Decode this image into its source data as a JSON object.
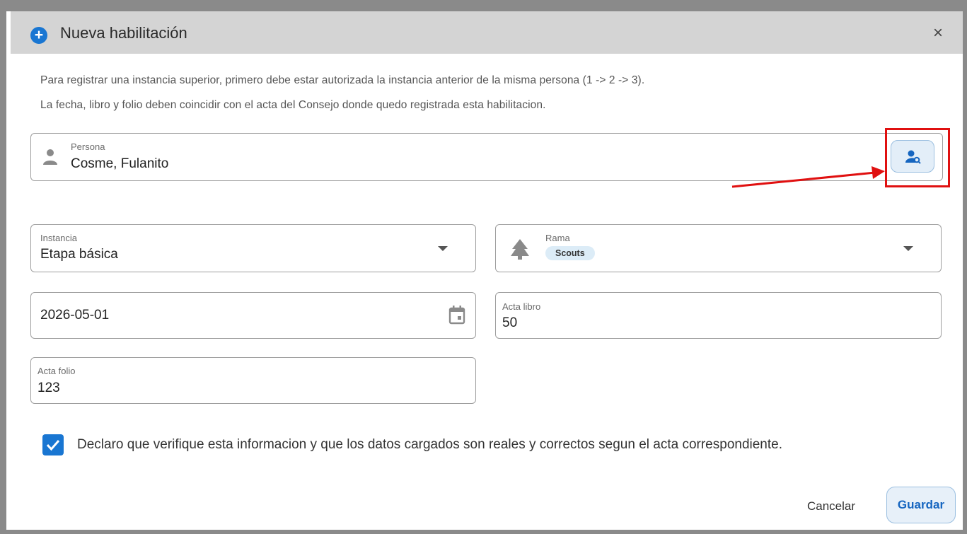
{
  "dialog": {
    "title": "Nueva habilitación",
    "close_label": "×"
  },
  "info": {
    "line1": "Para registrar una instancia superior, primero debe estar autorizada la instancia anterior de la misma persona (1 -> 2 -> 3).",
    "line2": "La fecha, libro y folio deben coincidir con el acta del Consejo donde quedo registrada esta habilitacion."
  },
  "persona": {
    "label": "Persona",
    "value": "Cosme, Fulanito"
  },
  "instancia": {
    "label": "Instancia",
    "value": "Etapa básica"
  },
  "rama": {
    "label": "Rama",
    "chip": "Scouts"
  },
  "fecha": {
    "value": "2026-05-01"
  },
  "acta_libro": {
    "label": "Acta libro",
    "value": "50"
  },
  "acta_folio": {
    "label": "Acta folio",
    "value": "123"
  },
  "declaracion": {
    "checked": true,
    "text": "Declaro que verifique esta informacion y que los datos cargados son reales y correctos segun el acta correspondiente."
  },
  "actions": {
    "cancel_label": "Cancelar",
    "save_label": "Guardar"
  },
  "colors": {
    "accent": "#1976d2",
    "annotation": "#e01010"
  }
}
